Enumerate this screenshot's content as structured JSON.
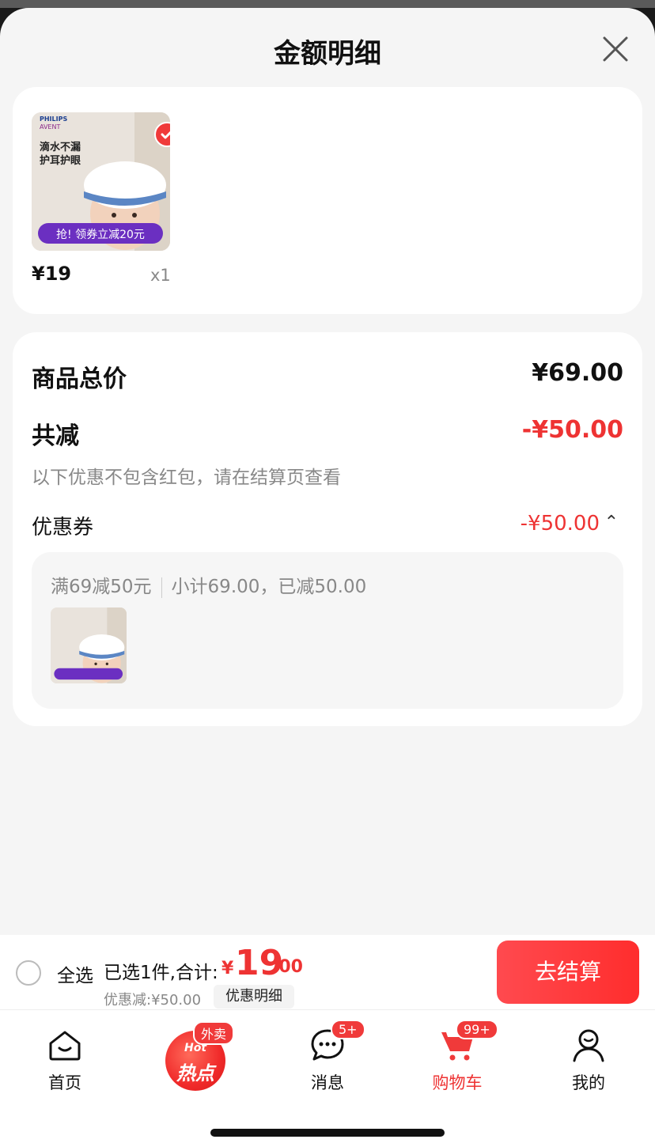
{
  "sheet": {
    "title": "金额明细"
  },
  "product": {
    "image_texts": {
      "brand1": "PHILIPS",
      "brand2": "AVENT",
      "slogan": "滴水不漏\n护耳护眼",
      "promo": "抢! 领券立减20元"
    },
    "price": "¥19",
    "qty": "x1",
    "selected": true
  },
  "summary": {
    "total_label": "商品总价",
    "total_value": "¥69.00",
    "discount_label": "共减",
    "discount_value": "-¥50.00",
    "hint": "以下优惠不包含红包，请在结算页查看",
    "coupon_label": "优惠券",
    "coupon_value": "-¥50.00",
    "coupon_caret": "⌃",
    "coupon_rule": "满69减50元",
    "coupon_detail": "小计69.00，已减50.00"
  },
  "checkout_bar": {
    "select_all": "全选",
    "selected_text": "已选1件,合计:",
    "total_currency": "¥",
    "total_int": "19",
    "total_dec": ".00",
    "discount_line": "优惠减:¥50.00",
    "detail_button": "优惠明细",
    "checkout_button": "去结算"
  },
  "tabbar": {
    "items": [
      {
        "label": "首页",
        "icon": "home-icon"
      },
      {
        "label": "",
        "icon": "hot-icon",
        "hot_top": "Hot",
        "hot_main": "热点",
        "badge": "外卖"
      },
      {
        "label": "消息",
        "icon": "message-icon",
        "badge": "5+"
      },
      {
        "label": "购物车",
        "icon": "cart-icon",
        "badge": "99+",
        "active": true
      },
      {
        "label": "我的",
        "icon": "user-icon"
      }
    ]
  },
  "colors": {
    "accent": "#f03a3a",
    "price_red": "#e33333",
    "background": "#f5f5f5"
  }
}
